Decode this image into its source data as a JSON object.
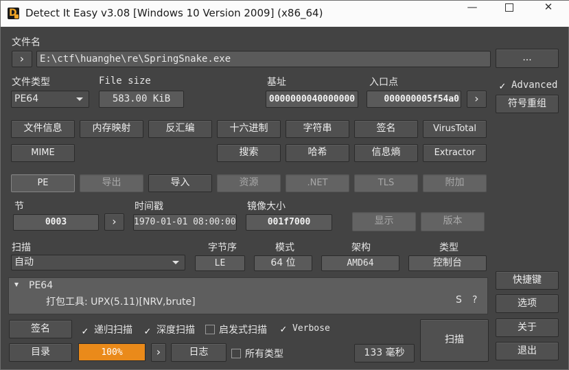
{
  "window": {
    "title": "Detect It Easy v3.08 [Windows 10 Version 2009] (x86_64)",
    "min_glyph": "—",
    "close_glyph": "✕"
  },
  "file": {
    "label": "文件名",
    "path": "E:\\ctf\\huanghe\\re\\SpringSnake.exe",
    "expand_glyph": "›",
    "browse_label": "..."
  },
  "info": {
    "type_label": "文件类型",
    "type_value": "PE64",
    "size_label": "File size",
    "size_value": "583.00 KiB",
    "base_label": "基址",
    "base_value": "0000000040000000",
    "entry_label": "入口点",
    "entry_value": "000000005f54a0",
    "entry_go_glyph": "›",
    "advanced_label": "Advanced",
    "advanced_checked": true,
    "symbols_label": "符号重组"
  },
  "tools_row1": [
    "文件信息",
    "内存映射",
    "反汇编",
    "十六进制",
    "字符串",
    "签名",
    "VirusTotal"
  ],
  "tools_row2": {
    "mime": "MIME",
    "search": "搜索",
    "hash": "哈希",
    "entropy": "信息熵",
    "extractor": "Extractor"
  },
  "pe_row": {
    "pe": "PE",
    "export": "导出",
    "import": "导入",
    "resource": "资源",
    "net": ".NET",
    "tls": "TLS",
    "overlay": "附加"
  },
  "section": {
    "label": "节",
    "value": "0003",
    "go_glyph": "›",
    "time_label": "时间戳",
    "time_value": "1970-01-01 08:00:00",
    "image_label": "镜像大小",
    "image_value": "001f7000",
    "show_label": "显示",
    "version_label": "版本"
  },
  "scan": {
    "label": "扫描",
    "mode_value": "自动",
    "endian_label": "字节序",
    "endian_value": "LE",
    "mode_label": "模式",
    "bits_value": "64 位",
    "arch_label": "架构",
    "arch_value": "AMD64",
    "type_label": "类型",
    "type_value": "控制台"
  },
  "result": {
    "tree_glyph": "▾",
    "node": "PE64",
    "detect": "打包工具: UPX(5.11)[NRV,brute]",
    "s_flag": "S",
    "q_flag": "?"
  },
  "side_buttons": {
    "shortcuts": "快捷键",
    "options": "选项",
    "about": "关于",
    "exit": "退出"
  },
  "bottom": {
    "signatures_label": "签名",
    "recursive_label": "递归扫描",
    "recursive_checked": true,
    "deep_label": "深度扫描",
    "deep_checked": true,
    "heuristic_label": "启发式扫描",
    "heuristic_checked": false,
    "verbose_label": "Verbose",
    "verbose_checked": true,
    "dir_label": "目录",
    "progress_text": "100%",
    "progress_value": 1.0,
    "next_glyph": "›",
    "log_label": "日志",
    "alltypes_label": "所有类型",
    "alltypes_checked": false,
    "time_text": "133 毫秒",
    "scan_label": "扫描",
    "check_glyph": "✓"
  },
  "colors": {
    "background": "#434343",
    "progress": "#ea8a1a",
    "titlebar": "#fbfbfb",
    "accent_logo": "#f0a526"
  }
}
